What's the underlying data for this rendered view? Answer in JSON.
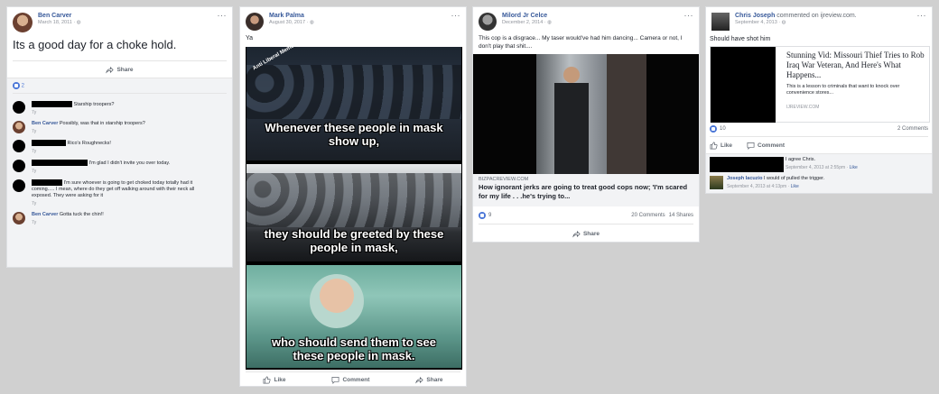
{
  "post1": {
    "author": "Ben Carver",
    "date": "March 18, 2011 · ",
    "text": "Its a good day for a choke hold.",
    "reaction_count": "2",
    "share": "Share",
    "comments": [
      {
        "text": "Starship troopers?",
        "ago": "7y"
      },
      {
        "name": "Ben Carver",
        "text": "Possibly, was that in starship troopers?",
        "ago": "7y"
      },
      {
        "text": "Rico's Roughnecks!",
        "ago": "7y"
      },
      {
        "text": "I'm glad I didn't invite you over today.",
        "ago": "7y"
      },
      {
        "text": "I'm sure whoever is going to get choked today totally had it coming..... I mean, where do they get off walking around with their neck all exposed. They were asking for it",
        "ago": "7y"
      },
      {
        "name": "Ben Carver",
        "text": "Gotta tuck the chin!!",
        "ago": "7y"
      }
    ]
  },
  "post2": {
    "author": "Mark Palma",
    "date": "August 30, 2017 · ",
    "text": "Ya",
    "meme": {
      "watermark": "Anti Liberal Memes",
      "line1": "Whenever these people in mask show up,",
      "line2": "they should be greeted by these people in mask,",
      "line3": "who should send them to see these people in mask."
    },
    "like": "Like",
    "comment": "Comment",
    "share": "Share"
  },
  "post3": {
    "author": "Milord Jr Celce",
    "date": "December 2, 2014 · ",
    "text": "This cop is a disgrace... My taser would've had him dancing... Camera or not, I don't play that shit....",
    "link_domain": "BIZPACREVIEW.COM",
    "link_title": "How ignorant jerks are going to treat good cops now; 'I'm scared for my life . . .he's trying to...",
    "reaction_count": "9",
    "comments_count": "20 Comments",
    "shares_count": "14 Shares",
    "share": "Share"
  },
  "post4": {
    "author": "Chris Joseph",
    "author_suffix": " commented on ijreview.com.",
    "date": "September 4, 2013 · ",
    "text": "Should have shot him",
    "link_title": "Stunning Vid: Missouri Thief Tries to Rob Iraq War Veteran, And Here's What Happens...",
    "link_desc": "This is a lesson to criminals that want to knock over convenience stores...",
    "link_domain": "IJREVIEW.COM",
    "reaction_count": "10",
    "comments_count": "2 Comments",
    "like": "Like",
    "comment": "Comment",
    "replies": [
      {
        "text": "I agree Chris.",
        "meta": "September 4, 2013 at 2:55pm · ",
        "like": "Like"
      },
      {
        "name": "Joseph Iacuzio",
        "text": "I would of pulled the trigger.",
        "meta": "September 4, 2013 at 4:13pm · ",
        "like": "Like"
      }
    ]
  },
  "colors": {
    "link": "#365899",
    "like_blue": "#4a76d7",
    "background": "#d0d0d0"
  }
}
